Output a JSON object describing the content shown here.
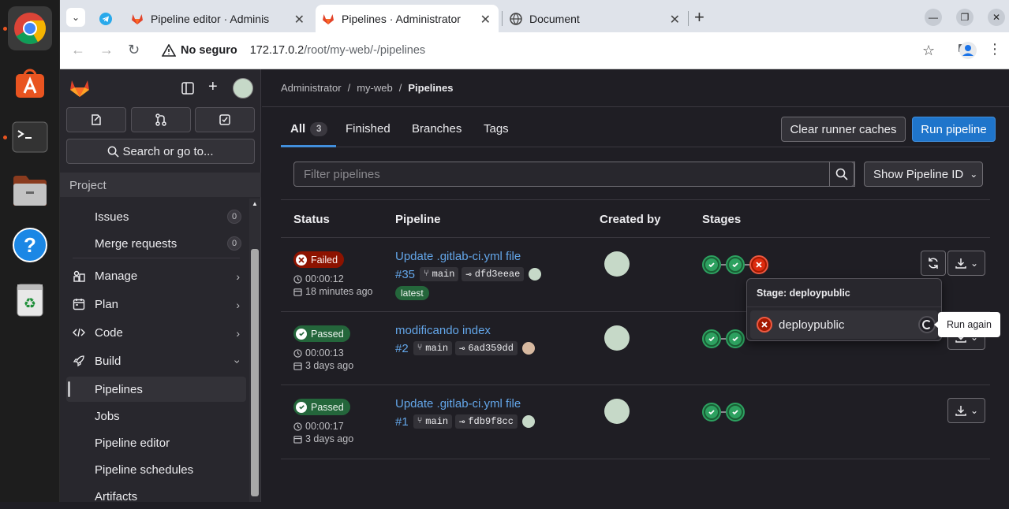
{
  "browser": {
    "tabs": [
      {
        "title": "Pipeline editor · Adminis",
        "active": false
      },
      {
        "title": "Pipelines · Administrator",
        "active": true
      },
      {
        "title": "Document",
        "active": false
      }
    ],
    "security_label": "No seguro",
    "url_host": "172.17.0.2",
    "url_path": "/root/my-web/-/pipelines"
  },
  "sidebar": {
    "search_label": "Search or go to...",
    "section_label": "Project",
    "items": [
      {
        "label": "Issues",
        "badge": "0"
      },
      {
        "label": "Merge requests",
        "badge": "0"
      },
      {
        "label": "Manage"
      },
      {
        "label": "Plan"
      },
      {
        "label": "Code"
      },
      {
        "label": "Build"
      },
      {
        "label": "Pipelines"
      },
      {
        "label": "Jobs"
      },
      {
        "label": "Pipeline editor"
      },
      {
        "label": "Pipeline schedules"
      },
      {
        "label": "Artifacts"
      }
    ]
  },
  "breadcrumb": [
    "Administrator",
    "my-web",
    "Pipelines"
  ],
  "tabs": {
    "all": "All",
    "all_count": "3",
    "finished": "Finished",
    "branches": "Branches",
    "tags": "Tags"
  },
  "actions": {
    "clear_caches": "Clear runner caches",
    "run_pipeline": "Run pipeline"
  },
  "filter": {
    "placeholder": "Filter pipelines",
    "display_select": "Show Pipeline ID"
  },
  "table": {
    "headers": {
      "status": "Status",
      "pipeline": "Pipeline",
      "created_by": "Created by",
      "stages": "Stages"
    },
    "rows": [
      {
        "status": "Failed",
        "duration": "00:00:12",
        "ago": "18 minutes ago",
        "title": "Update .gitlab-ci.yml file",
        "id": "#35",
        "branch": "main",
        "commit": "dfd3eeae",
        "badge": "latest"
      },
      {
        "status": "Passed",
        "duration": "00:00:13",
        "ago": "3 days ago",
        "title": "modificando index",
        "id": "#2",
        "branch": "main",
        "commit": "6ad359dd"
      },
      {
        "status": "Passed",
        "duration": "00:00:17",
        "ago": "3 days ago",
        "title": "Update .gitlab-ci.yml file",
        "id": "#1",
        "branch": "main",
        "commit": "fdb9f8cc"
      }
    ]
  },
  "popover": {
    "header": "Stage: deploypublic",
    "job": "deploypublic"
  },
  "tooltip": "Run again",
  "colors": {
    "failed": "#dd2b0e",
    "passed": "#2da160",
    "primary": "#1f75cb",
    "link": "#63a6e9"
  }
}
